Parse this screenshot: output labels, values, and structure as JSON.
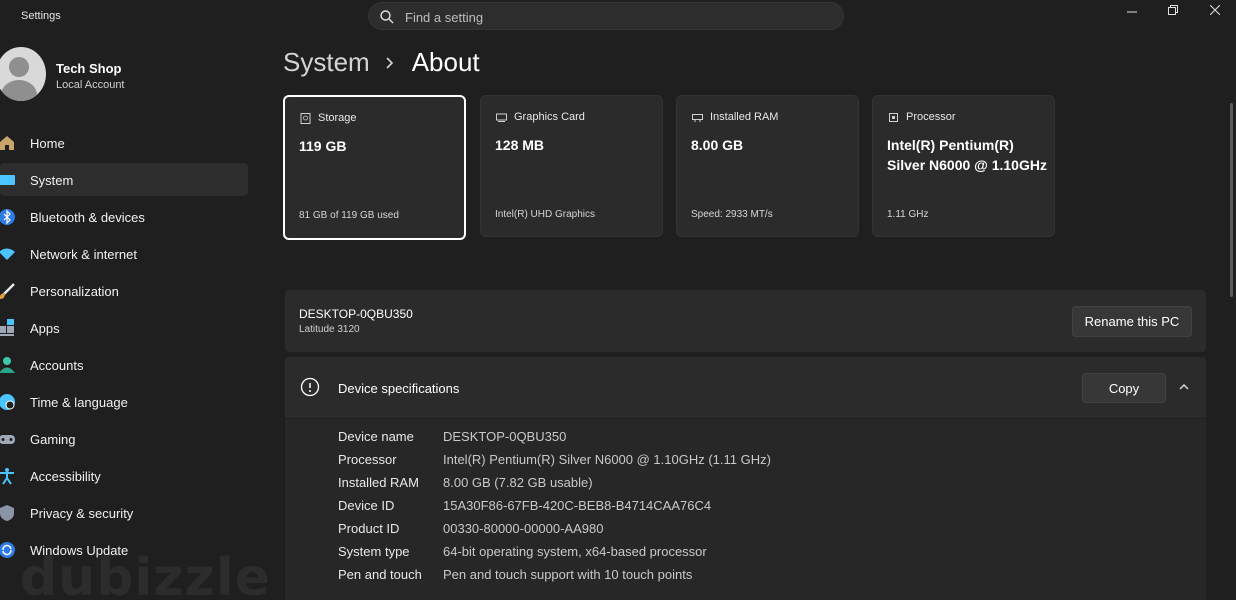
{
  "window": {
    "title": "Settings",
    "search_placeholder": "Find a setting"
  },
  "user": {
    "name": "Tech Shop",
    "account_type": "Local Account"
  },
  "sidebar": {
    "items": [
      {
        "label": "Home",
        "icon": "home-icon"
      },
      {
        "label": "System",
        "icon": "system-icon",
        "active": true
      },
      {
        "label": "Bluetooth & devices",
        "icon": "bluetooth-icon"
      },
      {
        "label": "Network & internet",
        "icon": "wifi-icon"
      },
      {
        "label": "Personalization",
        "icon": "brush-icon"
      },
      {
        "label": "Apps",
        "icon": "apps-icon"
      },
      {
        "label": "Accounts",
        "icon": "person-icon"
      },
      {
        "label": "Time & language",
        "icon": "globe-clock-icon"
      },
      {
        "label": "Gaming",
        "icon": "gamepad-icon"
      },
      {
        "label": "Accessibility",
        "icon": "accessibility-icon"
      },
      {
        "label": "Privacy & security",
        "icon": "shield-icon"
      },
      {
        "label": "Windows Update",
        "icon": "update-icon"
      }
    ]
  },
  "breadcrumb": {
    "parent": "System",
    "current": "About"
  },
  "cards": [
    {
      "heading": "Storage",
      "value": "119 GB",
      "footer": "81 GB of 119 GB used",
      "icon": "storage-icon"
    },
    {
      "heading": "Graphics Card",
      "value": "128 MB",
      "footer": "Intel(R) UHD Graphics",
      "icon": "graphics-card-icon"
    },
    {
      "heading": "Installed RAM",
      "value": "8.00 GB",
      "footer": "Speed: 2933 MT/s",
      "icon": "ram-icon"
    },
    {
      "heading": "Processor",
      "value": "Intel(R) Pentium(R) Silver N6000 @ 1.10GHz",
      "footer": "1.11 GHz",
      "icon": "processor-icon"
    }
  ],
  "pc": {
    "name": "DESKTOP-0QBU350",
    "model": "Latitude 3120",
    "rename_label": "Rename this PC"
  },
  "specs": {
    "title": "Device specifications",
    "copy_label": "Copy",
    "rows": [
      {
        "key": "Device name",
        "value": "DESKTOP-0QBU350"
      },
      {
        "key": "Processor",
        "value": "Intel(R) Pentium(R) Silver N6000 @ 1.10GHz (1.11 GHz)"
      },
      {
        "key": "Installed RAM",
        "value": "8.00 GB (7.82 GB usable)"
      },
      {
        "key": "Device ID",
        "value": "15A30F86-67FB-420C-BEB8-B4714CAA76C4"
      },
      {
        "key": "Product ID",
        "value": "00330-80000-00000-AA980"
      },
      {
        "key": "System type",
        "value": "64-bit operating system, x64-based processor"
      },
      {
        "key": "Pen and touch",
        "value": "Pen and touch support with 10 touch points"
      }
    ]
  },
  "watermark": "dubizzle",
  "colors": {
    "background": "#1f1f1f",
    "card": "#2b2b2b",
    "accent_blue": "#4cc2ff"
  }
}
